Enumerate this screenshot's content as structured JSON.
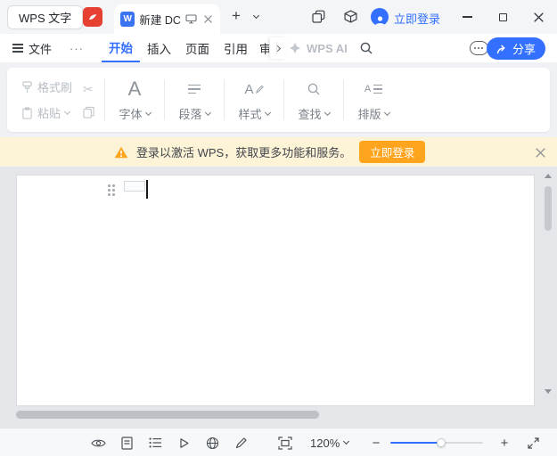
{
  "titlebar": {
    "app_tab_label": "WPS 文字",
    "doc_icon_letter": "W",
    "doc_tab_label": "新建 DC",
    "login_label": "立即登录"
  },
  "menubar": {
    "file_label": "文件",
    "more_label": "···",
    "tabs": [
      {
        "label": "开始",
        "active": true
      },
      {
        "label": "插入",
        "active": false
      },
      {
        "label": "页面",
        "active": false
      },
      {
        "label": "引用",
        "active": false
      },
      {
        "label": "审",
        "active": false
      }
    ],
    "wps_ai_label": "WPS AI",
    "share_label": "分享"
  },
  "ribbon": {
    "format_painter_label": "格式刷",
    "paste_label": "粘贴",
    "font_label": "字体",
    "font_icon_letter": "A",
    "paragraph_label": "段落",
    "style_label": "样式",
    "style_icon_letter": "A",
    "find_label": "查找",
    "layout_label": "排版",
    "layout_icon_letter": "A"
  },
  "banner": {
    "message": "登录以激活 WPS，获取更多功能和服务。",
    "login_button_label": "立即登录"
  },
  "statusbar": {
    "zoom_level": "120%"
  },
  "icons": {
    "scissors_glyph": "✂",
    "plus_glyph": "+",
    "minus_glyph": "−"
  },
  "colors": {
    "accent_blue": "#3370ff",
    "banner_bg": "#fdf3d7",
    "banner_button_orange": "#ffa41d",
    "docer_red": "#e64033",
    "doc_area_bg": "#e4e6e9"
  }
}
